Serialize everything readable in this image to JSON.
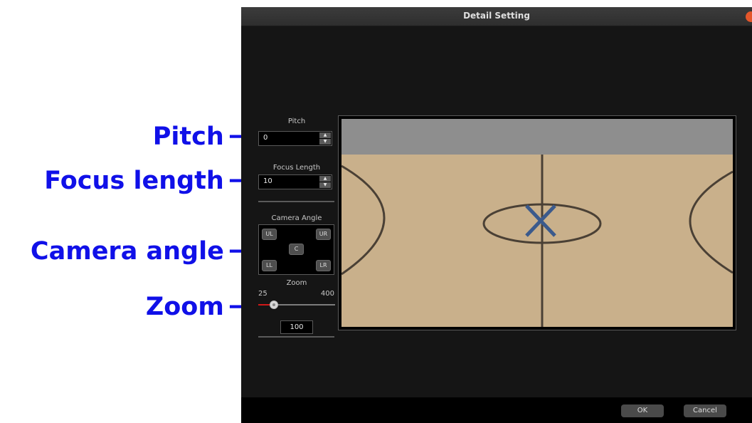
{
  "annotations": {
    "pitch": "Pitch",
    "focus": "Focus length",
    "camera": "Camera angle",
    "zoom": "Zoom",
    "arrow": "→"
  },
  "dialog": {
    "title": "Detail Setting",
    "colors": {
      "background": "#151515",
      "titlebar": "#353535",
      "close": "#e4562a"
    }
  },
  "pitch": {
    "label": "Pitch",
    "value": "0"
  },
  "focus": {
    "label": "Focus Length",
    "value": "10"
  },
  "spin": {
    "up": "▲",
    "down": "▼"
  },
  "camera_angle": {
    "label": "Camera Angle",
    "buttons": {
      "ul": "UL",
      "ur": "UR",
      "c": "C",
      "ll": "LL",
      "lr": "LR"
    }
  },
  "zoom": {
    "label": "Zoom",
    "min_label": "25",
    "max_label": "400",
    "min": 25,
    "max": 400,
    "value": 100,
    "value_text": "100"
  },
  "court": {
    "colors": {
      "floor": "#c9b08b",
      "lines": "#4a4035",
      "marker": "#3b5a8c",
      "stand": "#8e8e8e"
    }
  },
  "footer": {
    "ok": "OK",
    "cancel": "Cancel"
  }
}
